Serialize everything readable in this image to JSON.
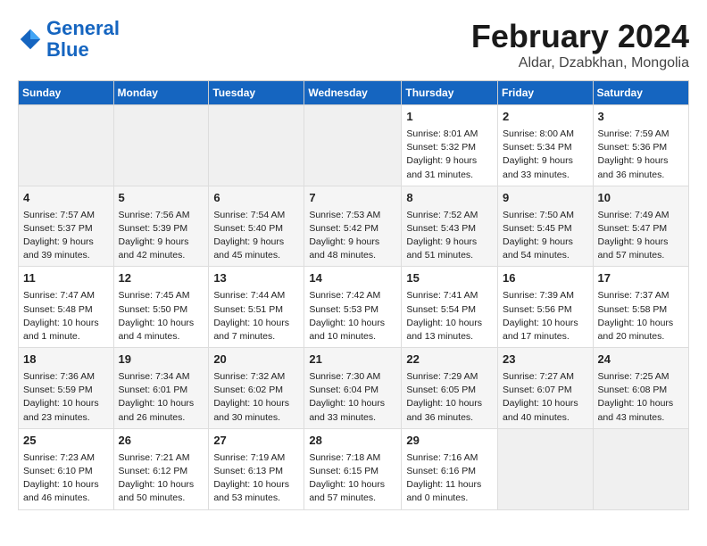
{
  "header": {
    "logo_line1": "General",
    "logo_line2": "Blue",
    "month": "February 2024",
    "location": "Aldar, Dzabkhan, Mongolia"
  },
  "days_of_week": [
    "Sunday",
    "Monday",
    "Tuesday",
    "Wednesday",
    "Thursday",
    "Friday",
    "Saturday"
  ],
  "weeks": [
    [
      {
        "day": "",
        "info": ""
      },
      {
        "day": "",
        "info": ""
      },
      {
        "day": "",
        "info": ""
      },
      {
        "day": "",
        "info": ""
      },
      {
        "day": "1",
        "info": "Sunrise: 8:01 AM\nSunset: 5:32 PM\nDaylight: 9 hours\nand 31 minutes."
      },
      {
        "day": "2",
        "info": "Sunrise: 8:00 AM\nSunset: 5:34 PM\nDaylight: 9 hours\nand 33 minutes."
      },
      {
        "day": "3",
        "info": "Sunrise: 7:59 AM\nSunset: 5:36 PM\nDaylight: 9 hours\nand 36 minutes."
      }
    ],
    [
      {
        "day": "4",
        "info": "Sunrise: 7:57 AM\nSunset: 5:37 PM\nDaylight: 9 hours\nand 39 minutes."
      },
      {
        "day": "5",
        "info": "Sunrise: 7:56 AM\nSunset: 5:39 PM\nDaylight: 9 hours\nand 42 minutes."
      },
      {
        "day": "6",
        "info": "Sunrise: 7:54 AM\nSunset: 5:40 PM\nDaylight: 9 hours\nand 45 minutes."
      },
      {
        "day": "7",
        "info": "Sunrise: 7:53 AM\nSunset: 5:42 PM\nDaylight: 9 hours\nand 48 minutes."
      },
      {
        "day": "8",
        "info": "Sunrise: 7:52 AM\nSunset: 5:43 PM\nDaylight: 9 hours\nand 51 minutes."
      },
      {
        "day": "9",
        "info": "Sunrise: 7:50 AM\nSunset: 5:45 PM\nDaylight: 9 hours\nand 54 minutes."
      },
      {
        "day": "10",
        "info": "Sunrise: 7:49 AM\nSunset: 5:47 PM\nDaylight: 9 hours\nand 57 minutes."
      }
    ],
    [
      {
        "day": "11",
        "info": "Sunrise: 7:47 AM\nSunset: 5:48 PM\nDaylight: 10 hours\nand 1 minute."
      },
      {
        "day": "12",
        "info": "Sunrise: 7:45 AM\nSunset: 5:50 PM\nDaylight: 10 hours\nand 4 minutes."
      },
      {
        "day": "13",
        "info": "Sunrise: 7:44 AM\nSunset: 5:51 PM\nDaylight: 10 hours\nand 7 minutes."
      },
      {
        "day": "14",
        "info": "Sunrise: 7:42 AM\nSunset: 5:53 PM\nDaylight: 10 hours\nand 10 minutes."
      },
      {
        "day": "15",
        "info": "Sunrise: 7:41 AM\nSunset: 5:54 PM\nDaylight: 10 hours\nand 13 minutes."
      },
      {
        "day": "16",
        "info": "Sunrise: 7:39 AM\nSunset: 5:56 PM\nDaylight: 10 hours\nand 17 minutes."
      },
      {
        "day": "17",
        "info": "Sunrise: 7:37 AM\nSunset: 5:58 PM\nDaylight: 10 hours\nand 20 minutes."
      }
    ],
    [
      {
        "day": "18",
        "info": "Sunrise: 7:36 AM\nSunset: 5:59 PM\nDaylight: 10 hours\nand 23 minutes."
      },
      {
        "day": "19",
        "info": "Sunrise: 7:34 AM\nSunset: 6:01 PM\nDaylight: 10 hours\nand 26 minutes."
      },
      {
        "day": "20",
        "info": "Sunrise: 7:32 AM\nSunset: 6:02 PM\nDaylight: 10 hours\nand 30 minutes."
      },
      {
        "day": "21",
        "info": "Sunrise: 7:30 AM\nSunset: 6:04 PM\nDaylight: 10 hours\nand 33 minutes."
      },
      {
        "day": "22",
        "info": "Sunrise: 7:29 AM\nSunset: 6:05 PM\nDaylight: 10 hours\nand 36 minutes."
      },
      {
        "day": "23",
        "info": "Sunrise: 7:27 AM\nSunset: 6:07 PM\nDaylight: 10 hours\nand 40 minutes."
      },
      {
        "day": "24",
        "info": "Sunrise: 7:25 AM\nSunset: 6:08 PM\nDaylight: 10 hours\nand 43 minutes."
      }
    ],
    [
      {
        "day": "25",
        "info": "Sunrise: 7:23 AM\nSunset: 6:10 PM\nDaylight: 10 hours\nand 46 minutes."
      },
      {
        "day": "26",
        "info": "Sunrise: 7:21 AM\nSunset: 6:12 PM\nDaylight: 10 hours\nand 50 minutes."
      },
      {
        "day": "27",
        "info": "Sunrise: 7:19 AM\nSunset: 6:13 PM\nDaylight: 10 hours\nand 53 minutes."
      },
      {
        "day": "28",
        "info": "Sunrise: 7:18 AM\nSunset: 6:15 PM\nDaylight: 10 hours\nand 57 minutes."
      },
      {
        "day": "29",
        "info": "Sunrise: 7:16 AM\nSunset: 6:16 PM\nDaylight: 11 hours\nand 0 minutes."
      },
      {
        "day": "",
        "info": ""
      },
      {
        "day": "",
        "info": ""
      }
    ]
  ]
}
